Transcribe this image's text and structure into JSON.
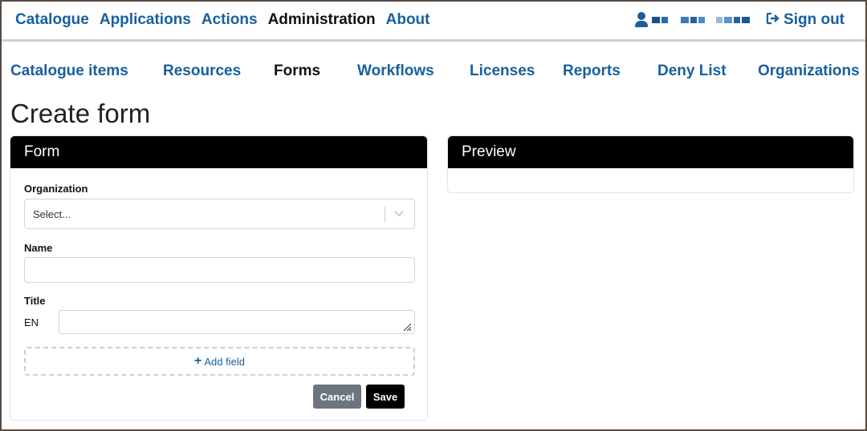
{
  "topnav": {
    "items": [
      {
        "label": "Catalogue"
      },
      {
        "label": "Applications"
      },
      {
        "label": "Actions"
      },
      {
        "label": "Administration"
      },
      {
        "label": "About"
      }
    ],
    "signout_label": "Sign out"
  },
  "subnav": {
    "items": [
      {
        "label": "Catalogue items"
      },
      {
        "label": "Resources"
      },
      {
        "label": "Forms"
      },
      {
        "label": "Workflows"
      },
      {
        "label": "Licenses"
      },
      {
        "label": "Reports"
      },
      {
        "label": "Deny List"
      },
      {
        "label": "Organizations"
      }
    ]
  },
  "page": {
    "title": "Create form"
  },
  "form_card": {
    "header": "Form",
    "organization_label": "Organization",
    "organization_placeholder": "Select...",
    "name_label": "Name",
    "name_value": "",
    "title_label": "Title",
    "title_lang": "EN",
    "title_value": "",
    "add_field_label": "Add field",
    "cancel_label": "Cancel",
    "save_label": "Save"
  },
  "preview_card": {
    "header": "Preview"
  },
  "colors": {
    "link": "#17609d",
    "header_bg": "#000000",
    "cancel_bg": "#6c757d",
    "save_bg": "#000000"
  }
}
